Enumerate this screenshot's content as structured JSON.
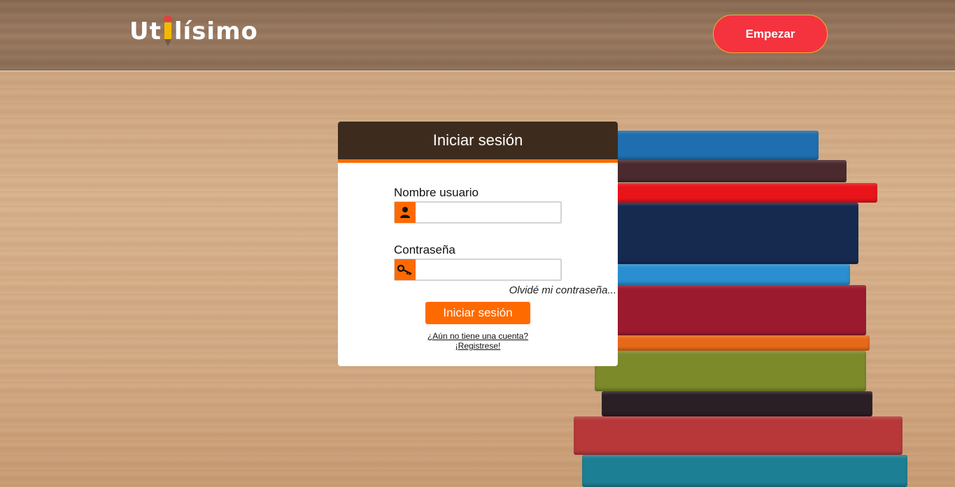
{
  "header": {
    "logo_text_before": "Ut",
    "logo_text_after": "lísimo",
    "start_button": "Empezar"
  },
  "login": {
    "title": "Iniciar sesión",
    "username_label": "Nombre usuario",
    "username_value": "",
    "password_label": "Contraseña",
    "password_value": "",
    "forgot_link": "Olvidé mi contraseña...",
    "submit_button": "Iniciar sesión",
    "no_account_text": "¿Aún no tiene una cuenta?",
    "register_link": "¡Registrese!"
  },
  "colors": {
    "accent": "#ff6a00",
    "card_header": "#3d2c1e",
    "start_button": "#f4333f"
  },
  "icons": {
    "username": "user-icon",
    "password": "key-icon",
    "logo": "pencil-icon"
  }
}
